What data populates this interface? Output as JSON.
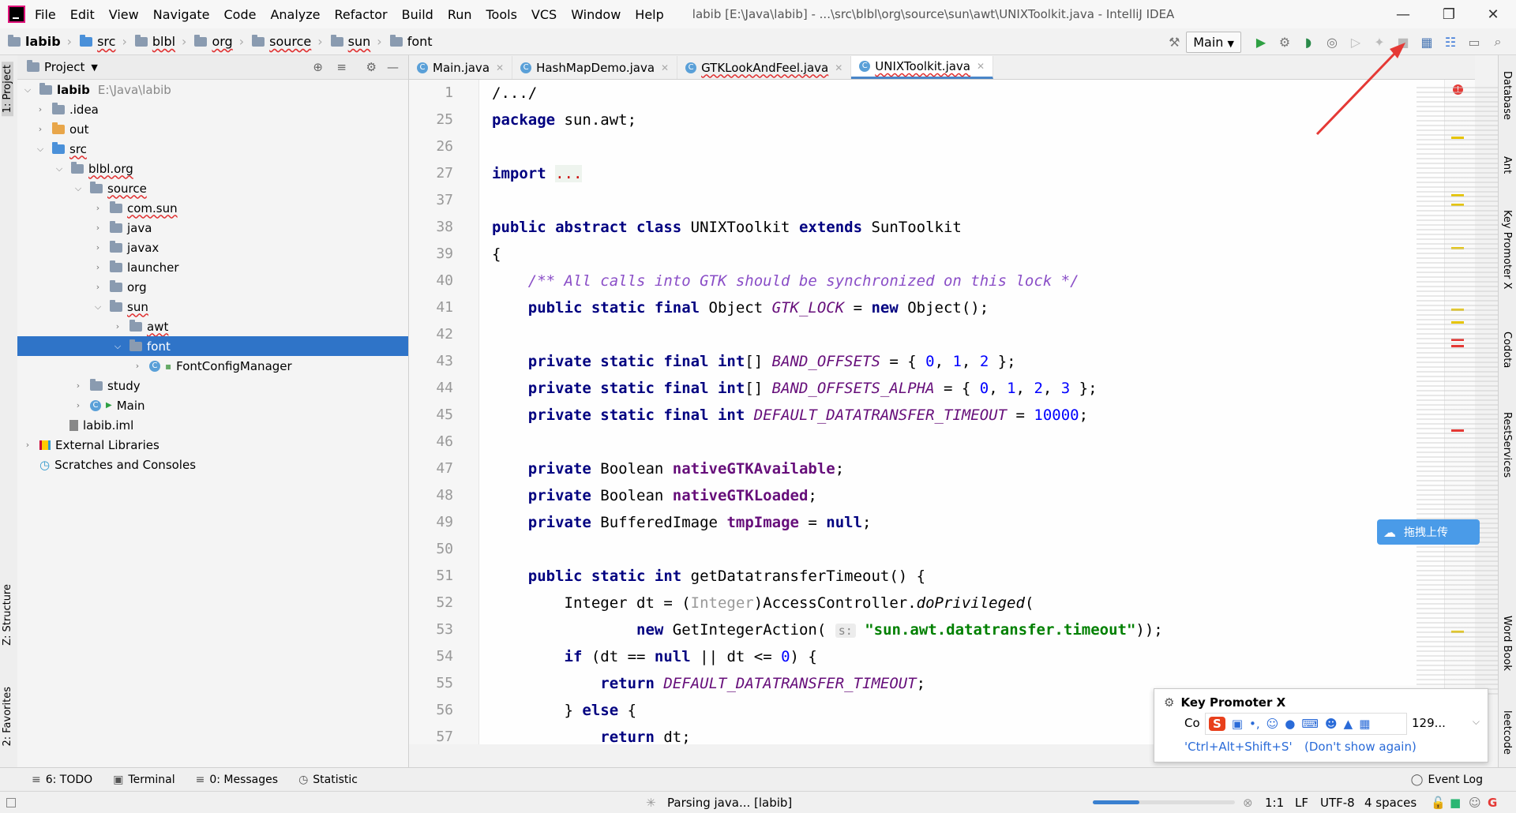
{
  "window": {
    "title": "labib [E:\\Java\\labib] - ...\\src\\blbl\\org\\source\\sun\\awt\\UNIXToolkit.java - IntelliJ IDEA",
    "menu": [
      "File",
      "Edit",
      "View",
      "Navigate",
      "Code",
      "Analyze",
      "Refactor",
      "Build",
      "Run",
      "Tools",
      "VCS",
      "Window",
      "Help"
    ]
  },
  "breadcrumb": [
    "labib",
    "src",
    "blbl",
    "org",
    "source",
    "sun",
    "font"
  ],
  "run_config": "Main",
  "left_strip": {
    "project": "1: Project",
    "structure": "Z: Structure",
    "favorites": "2: Favorites"
  },
  "right_strip": [
    "Database",
    "Ant",
    "Key Promoter X",
    "Codota",
    "RestServices",
    "Word Book",
    "leetcode"
  ],
  "project_panel": {
    "title": "Project",
    "tree": [
      {
        "label": "labib",
        "extra": "E:\\Java\\labib"
      },
      {
        "label": ".idea"
      },
      {
        "label": "out"
      },
      {
        "label": "src"
      },
      {
        "label": "blbl.org"
      },
      {
        "label": "source"
      },
      {
        "label": "com.sun"
      },
      {
        "label": "java"
      },
      {
        "label": "javax"
      },
      {
        "label": "launcher"
      },
      {
        "label": "org"
      },
      {
        "label": "sun"
      },
      {
        "label": "awt"
      },
      {
        "label": "font"
      },
      {
        "label": "FontConfigManager"
      },
      {
        "label": "study"
      },
      {
        "label": "Main"
      },
      {
        "label": "labib.iml"
      },
      {
        "label": "External Libraries"
      },
      {
        "label": "Scratches and Consoles"
      }
    ]
  },
  "tabs": [
    "Main.java",
    "HashMapDemo.java",
    "GTKLookAndFeel.java",
    "UNIXToolkit.java"
  ],
  "editor": {
    "line_numbers": [
      "1",
      "25",
      "26",
      "27",
      "37",
      "38",
      "39",
      "40",
      "41",
      "42",
      "43",
      "44",
      "45",
      "46",
      "47",
      "48",
      "49",
      "50",
      "51",
      "52",
      "53",
      "54",
      "55",
      "56",
      "57"
    ]
  },
  "bottom_tools": [
    "6: TODO",
    "Terminal",
    "0: Messages",
    "Statistic",
    "Event Log"
  ],
  "status": {
    "parsing": "Parsing java... [labib]",
    "progress_fraction": 0.33,
    "position": "1:1",
    "line_sep": "LF",
    "encoding": "UTF-8",
    "indent": "4 spaces"
  },
  "popup": {
    "title": "Key Promoter X",
    "text_start": "Co",
    "text_end": "129...",
    "shortcut": "'Ctrl+Alt+Shift+S'",
    "dismiss": "(Don't show again)"
  },
  "upload_button": "拖拽上传",
  "colors": {
    "selection": "#2f74c8",
    "keyword": "#000080",
    "field": "#660e7a",
    "string": "#008000",
    "number": "#0000ff",
    "annotation_arrow": "#e53935"
  }
}
